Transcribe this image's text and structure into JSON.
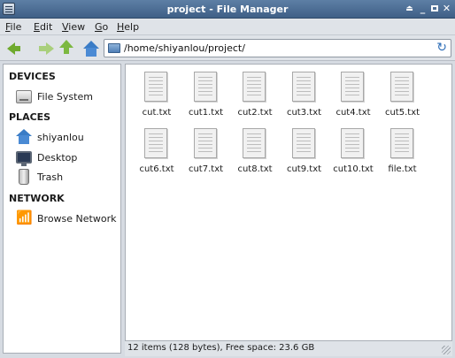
{
  "window": {
    "title": "project - File Manager",
    "buttons": {
      "eject": "⏏",
      "minimize": "_",
      "close": "✕"
    }
  },
  "menu": [
    {
      "label": "File",
      "accel": "F",
      "rest": "ile"
    },
    {
      "label": "Edit",
      "accel": "E",
      "rest": "dit"
    },
    {
      "label": "View",
      "accel": "V",
      "rest": "iew"
    },
    {
      "label": "Go",
      "accel": "G",
      "rest": "o"
    },
    {
      "label": "Help",
      "accel": "H",
      "rest": "elp"
    }
  ],
  "toolbar": {
    "path": "/home/shiyanlou/project/",
    "icons": [
      "back-arrow-icon",
      "forward-arrow-icon",
      "up-arrow-icon",
      "home-icon",
      "reload-icon"
    ]
  },
  "sidebar": {
    "devices_title": "DEVICES",
    "places_title": "PLACES",
    "network_title": "NETWORK",
    "devices": [
      {
        "label": "File System",
        "icon": "drive-icon"
      }
    ],
    "places": [
      {
        "label": "shiyanlou",
        "icon": "home-folder-icon"
      },
      {
        "label": "Desktop",
        "icon": "desktop-icon"
      },
      {
        "label": "Trash",
        "icon": "trash-icon"
      }
    ],
    "network": [
      {
        "label": "Browse Network",
        "icon": "wifi-icon"
      }
    ]
  },
  "files": [
    {
      "name": "cut.txt"
    },
    {
      "name": "cut1.txt"
    },
    {
      "name": "cut2.txt"
    },
    {
      "name": "cut3.txt"
    },
    {
      "name": "cut4.txt"
    },
    {
      "name": "cut5.txt"
    },
    {
      "name": "cut6.txt"
    },
    {
      "name": "cut7.txt"
    },
    {
      "name": "cut8.txt"
    },
    {
      "name": "cut9.txt"
    },
    {
      "name": "cut10.txt"
    },
    {
      "name": "file.txt"
    }
  ],
  "status": {
    "text": "12 items (128 bytes), Free space: 23.6 GB"
  }
}
